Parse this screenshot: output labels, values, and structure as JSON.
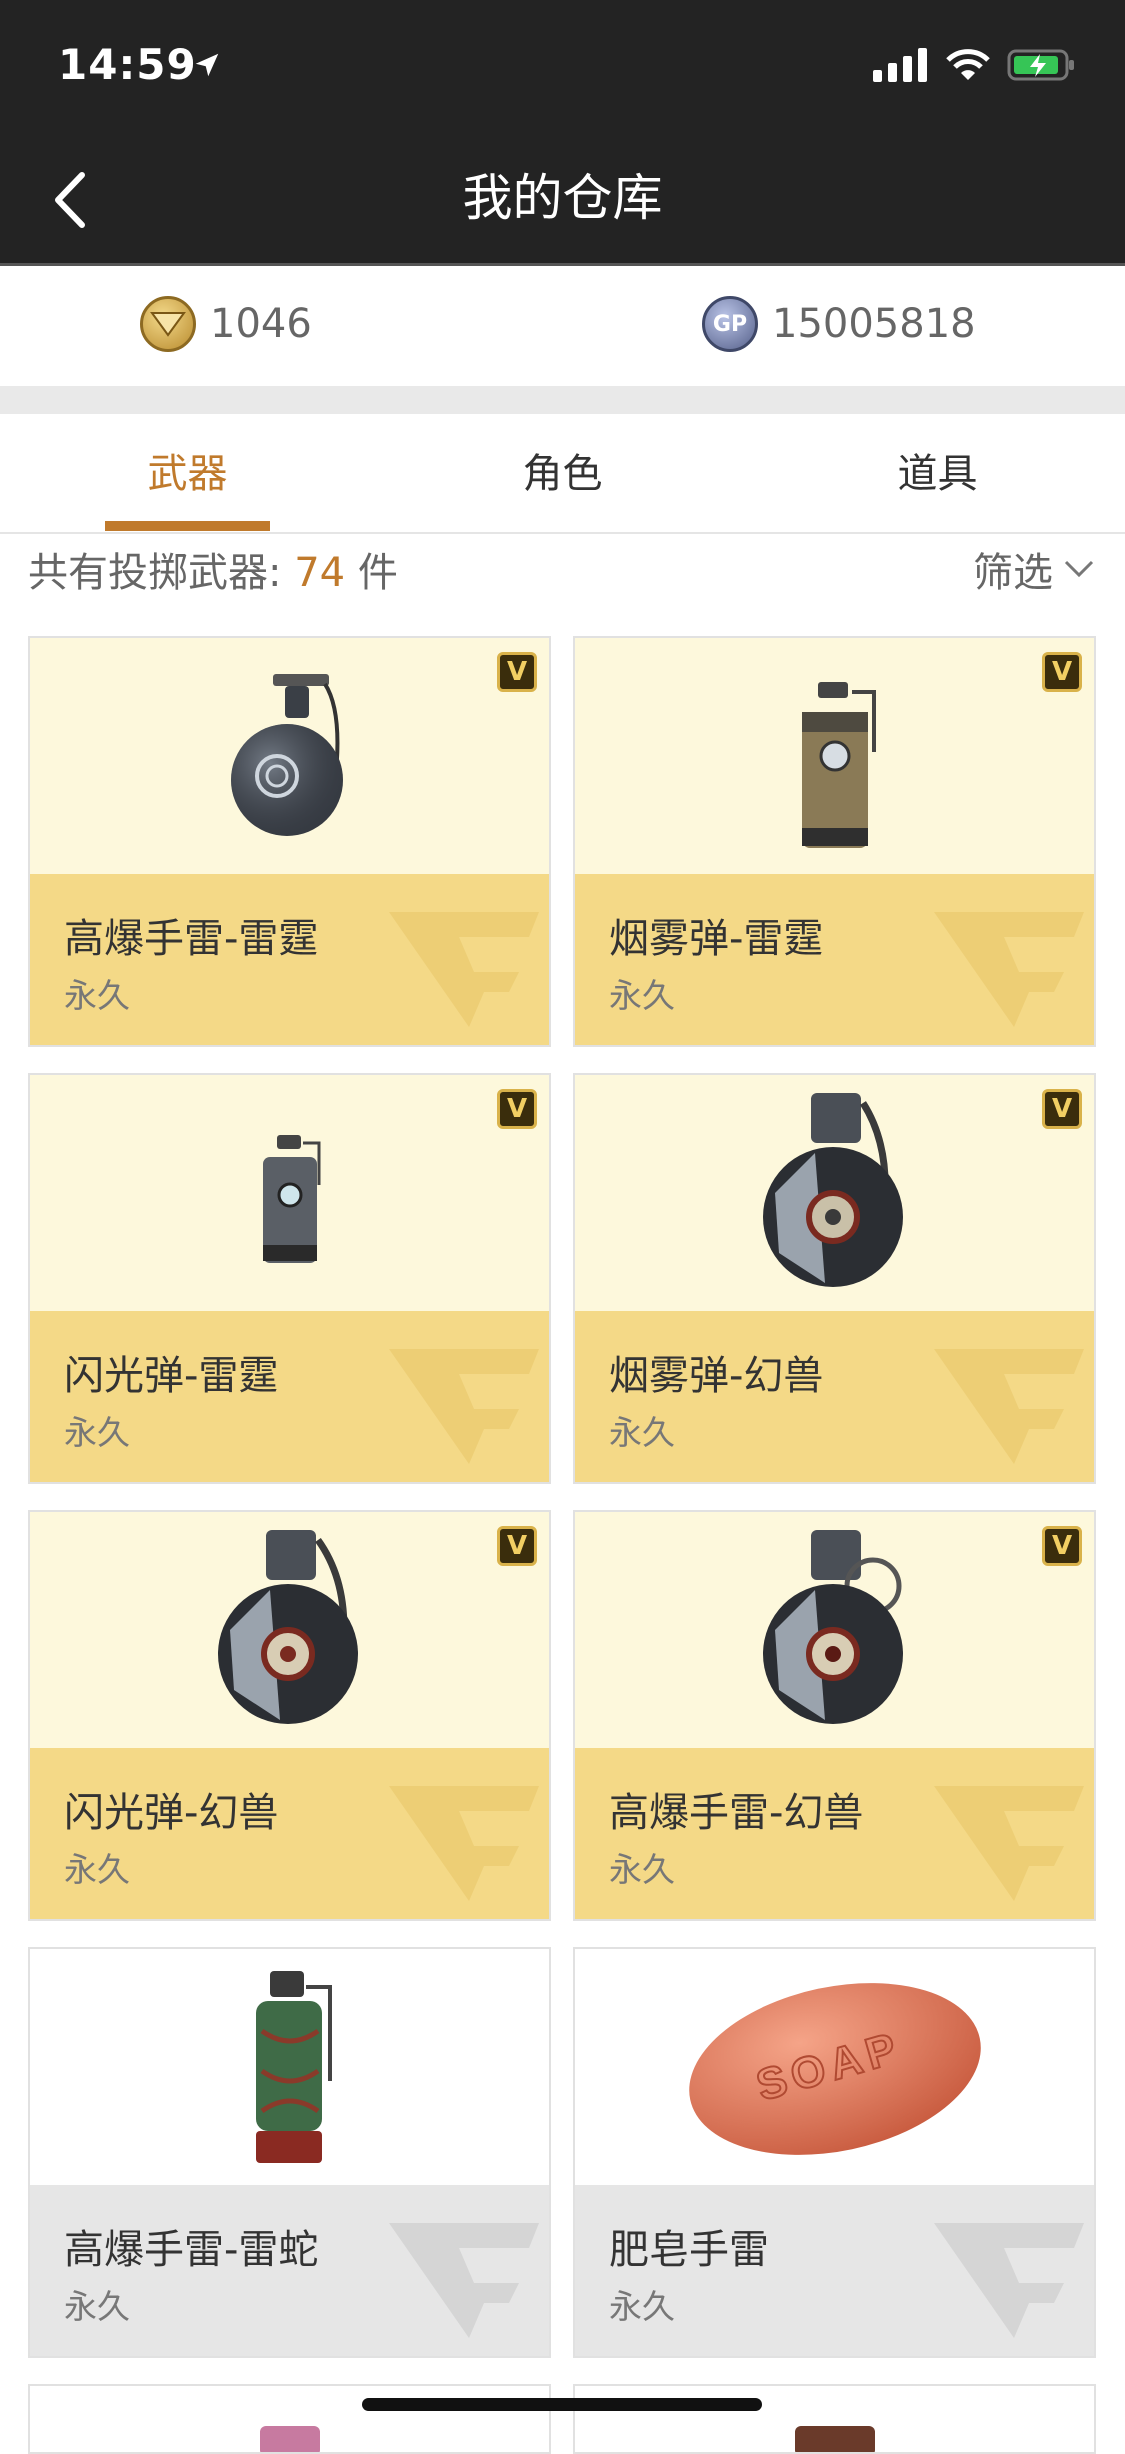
{
  "status_bar": {
    "time": "14:59"
  },
  "nav": {
    "title": "我的仓库"
  },
  "currency": {
    "cf_points": "1046",
    "gp": "15005818",
    "gp_label": "GP"
  },
  "tabs": [
    {
      "label": "武器",
      "active": true
    },
    {
      "label": "角色",
      "active": false
    },
    {
      "label": "道具",
      "active": false
    }
  ],
  "summary": {
    "prefix": "共有投掷武器: ",
    "count": "74",
    "suffix": " 件"
  },
  "filter": {
    "label": "筛选"
  },
  "items": [
    {
      "name": "高爆手雷-雷霆",
      "duration": "永久",
      "vip": true,
      "icon": "thunder-grenade-icon"
    },
    {
      "name": "烟雾弹-雷霆",
      "duration": "永久",
      "vip": true,
      "icon": "thunder-smoke-icon"
    },
    {
      "name": "闪光弹-雷霆",
      "duration": "永久",
      "vip": true,
      "icon": "thunder-flash-icon"
    },
    {
      "name": "烟雾弹-幻兽",
      "duration": "永久",
      "vip": true,
      "icon": "beast-smoke-icon"
    },
    {
      "name": "闪光弹-幻兽",
      "duration": "永久",
      "vip": true,
      "icon": "beast-flash-icon"
    },
    {
      "name": "高爆手雷-幻兽",
      "duration": "永久",
      "vip": true,
      "icon": "beast-grenade-icon"
    },
    {
      "name": "高爆手雷-雷蛇",
      "duration": "永久",
      "vip": false,
      "icon": "razer-grenade-icon"
    },
    {
      "name": "肥皂手雷",
      "duration": "永久",
      "vip": false,
      "icon": "soap-grenade-icon",
      "soap_text": "SOAP"
    }
  ],
  "vip_badge": "V",
  "colors": {
    "accent": "#c07a2c",
    "vip_top": "#fdf8dc",
    "vip_bottom": "#f4d987",
    "header": "#232323"
  }
}
